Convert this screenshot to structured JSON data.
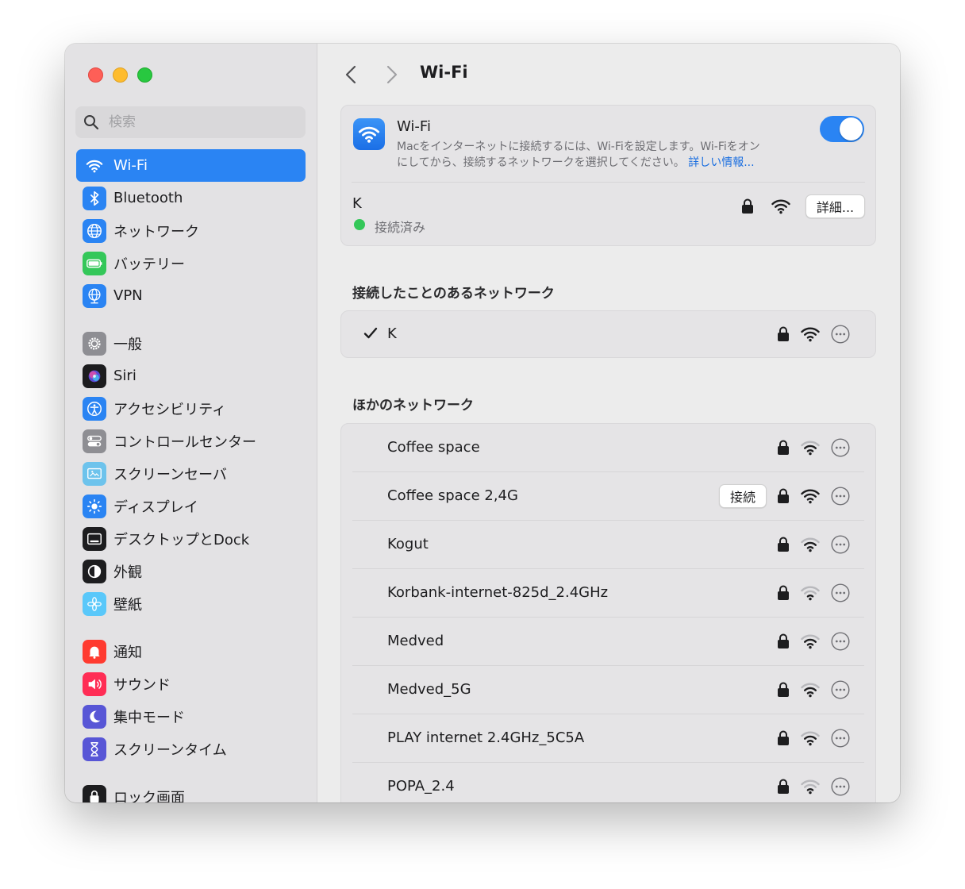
{
  "sidebar": {
    "search_placeholder": "検索",
    "items": [
      {
        "label": "Wi-Fi",
        "icon": "wifi-icon",
        "color": "#2a84f3",
        "active": true
      },
      {
        "label": "Bluetooth",
        "icon": "bluetooth-icon",
        "color": "#2a84f3"
      },
      {
        "label": "ネットワーク",
        "icon": "globe-icon",
        "color": "#2a84f3"
      },
      {
        "label": "バッテリー",
        "icon": "battery-icon",
        "color": "#34c759"
      },
      {
        "label": "VPN",
        "icon": "vpn-globe-icon",
        "color": "#2a84f3"
      },
      {
        "label": "一般",
        "icon": "gear-icon",
        "color": "#8e8e93"
      },
      {
        "label": "Siri",
        "icon": "siri-icon",
        "color": "#3a3a3c"
      },
      {
        "label": "アクセシビリティ",
        "icon": "accessibility-icon",
        "color": "#2a84f3"
      },
      {
        "label": "コントロールセンター",
        "icon": "control-center-icon",
        "color": "#8e8e93"
      },
      {
        "label": "スクリーンセーバ",
        "icon": "screensaver-icon",
        "color": "#5ac8fa"
      },
      {
        "label": "ディスプレイ",
        "icon": "sun-icon",
        "color": "#2a84f3"
      },
      {
        "label": "デスクトップとDock",
        "icon": "dock-icon",
        "color": "#1d1d1f"
      },
      {
        "label": "外観",
        "icon": "appearance-icon",
        "color": "#1d1d1f"
      },
      {
        "label": "壁紙",
        "icon": "wallpaper-icon",
        "color": "#5ac8fa"
      },
      {
        "label": "通知",
        "icon": "bell-icon",
        "color": "#ff3b30"
      },
      {
        "label": "サウンド",
        "icon": "speaker-icon",
        "color": "#ff2d55"
      },
      {
        "label": "集中モード",
        "icon": "moon-icon",
        "color": "#5856d6"
      },
      {
        "label": "スクリーンタイム",
        "icon": "hourglass-icon",
        "color": "#5856d6"
      },
      {
        "label": "ロック画面",
        "icon": "lock-screen-icon",
        "color": "#1d1d1f"
      }
    ]
  },
  "header": {
    "title": "Wi-Fi"
  },
  "wifi_card": {
    "title": "Wi-Fi",
    "description_line1": "Macをインターネットに接続するには、Wi-Fiを設定します。Wi-Fiをオン",
    "description_line2": "にしてから、接続するネットワークを選択してください。",
    "learn_more": "詳しい情報...",
    "toggle_on": true,
    "current_network": "K",
    "status": "接続済み",
    "details_button": "詳細..."
  },
  "known_networks": {
    "title": "接続したことのあるネットワーク",
    "items": [
      {
        "name": "K",
        "checked": true
      }
    ]
  },
  "other_networks": {
    "title": "ほかのネットワーク",
    "connect_label": "接続",
    "items": [
      {
        "name": "Coffee space",
        "signal": 2
      },
      {
        "name": "Coffee space 2,4G",
        "signal": 3
      },
      {
        "name": "Kogut",
        "signal": 2
      },
      {
        "name": "Korbank-internet-825d_2.4GHz",
        "signal": 1
      },
      {
        "name": "Medved",
        "signal": 2
      },
      {
        "name": "Medved_5G",
        "signal": 2
      },
      {
        "name": "PLAY internet 2.4GHz_5C5A",
        "signal": 2
      },
      {
        "name": "POPA_2.4",
        "signal": 1
      }
    ]
  },
  "colors": {
    "accent": "#2a84f3",
    "connected_dot": "#34c759"
  }
}
